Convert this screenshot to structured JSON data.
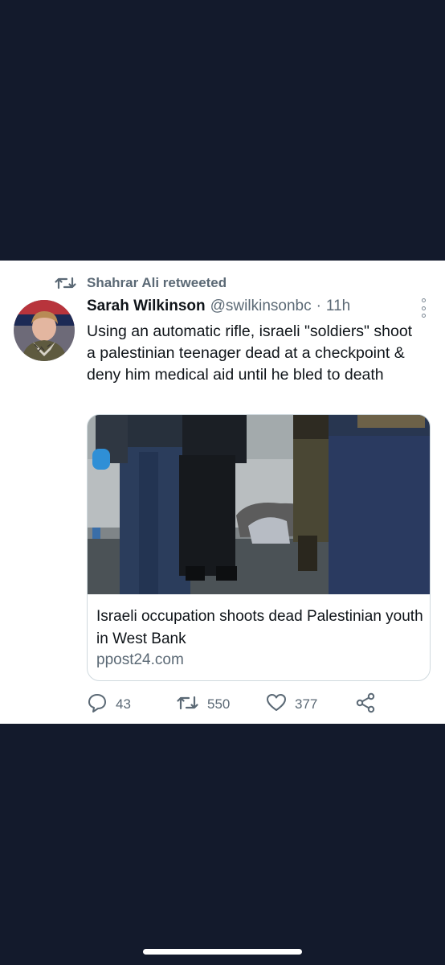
{
  "retweet": {
    "label": "Shahrar Ali retweeted"
  },
  "tweet": {
    "author_name": "Sarah Wilkinson",
    "handle": "@swilkinsonbc",
    "separator": "·",
    "time": "11h",
    "text": "Using an automatic rifle, israeli \"soldiers\" shoot a palestinian teenager dead at a checkpoint & deny him medical aid until he bled to death"
  },
  "link_card": {
    "title": "Israeli occupation shoots dead Palestinian youth in West Bank",
    "domain": "ppost24.com"
  },
  "actions": {
    "reply_count": "43",
    "retweet_count": "550",
    "like_count": "377"
  },
  "icons": {
    "retweet": "retweet-icon",
    "reply": "reply-icon",
    "like": "heart-icon",
    "share": "share-icon",
    "more": "more-options-icon"
  },
  "colors": {
    "background": "#131a2c",
    "card": "#ffffff",
    "text": "#0f1419",
    "secondary": "#5b6975"
  }
}
